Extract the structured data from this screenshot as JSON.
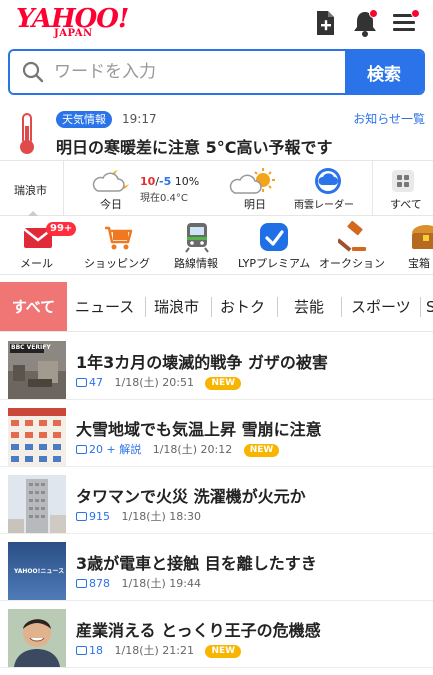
{
  "header": {
    "logo_main": "YAHOO!",
    "logo_sub": "JAPAN"
  },
  "search": {
    "placeholder": "ワードを入力",
    "button": "検索"
  },
  "info": {
    "badge": "天気情報",
    "time": "19:17",
    "link": "お知らせ一覧",
    "title": "明日の寒暖差に注意 5°C高い予報です"
  },
  "weather": {
    "city": "瑞浪市",
    "today_label": "今日",
    "today_high": "10",
    "today_sep": "/",
    "today_low": "-5",
    "today_precip": "10%",
    "now": "現在0.4°C",
    "tomorrow_label": "明日",
    "radar_label": "雨雲レーダー",
    "all_label": "すべて"
  },
  "services": [
    {
      "label": "メール",
      "icon": "mail-icon",
      "badge": "99+"
    },
    {
      "label": "ショッピング",
      "icon": "cart-icon"
    },
    {
      "label": "路線情報",
      "icon": "train-icon"
    },
    {
      "label": "LYPプレミアム",
      "icon": "premium-icon"
    },
    {
      "label": "オークション",
      "icon": "gavel-icon"
    },
    {
      "label": "宝箱",
      "icon": "treasure-icon"
    }
  ],
  "tabs": [
    "すべて",
    "ニュース",
    "瑞浪市",
    "おトク",
    "芸能",
    "スポーツ",
    "S"
  ],
  "news": [
    {
      "title": "1年3カ月の壊滅的戦争 ガザの被害",
      "comments": "47",
      "date": "1/18(土) 20:51",
      "new": "NEW",
      "thumb_label": "BBC VERIFY"
    },
    {
      "title": "大雪地域でも気温上昇 雪崩に注意",
      "comments": "20 + 解説",
      "date": "1/18(土) 20:12",
      "new": "NEW"
    },
    {
      "title": "タワマンで火災 洗濯機が火元か",
      "comments": "915",
      "date": "1/18(土) 18:30"
    },
    {
      "title": "3歳が電車と接触 目を離したすき",
      "comments": "878",
      "date": "1/18(土) 19:44",
      "thumb_label": "YAHOO!ニュース"
    },
    {
      "title": "産業消える とっくり王子の危機感",
      "comments": "18",
      "date": "1/18(土) 21:21",
      "new": "NEW"
    }
  ],
  "colors": {
    "brand": "#ff0033",
    "accent_blue": "#2a73e8",
    "active_tab": "#f07676",
    "new_badge": "#f7b500"
  }
}
